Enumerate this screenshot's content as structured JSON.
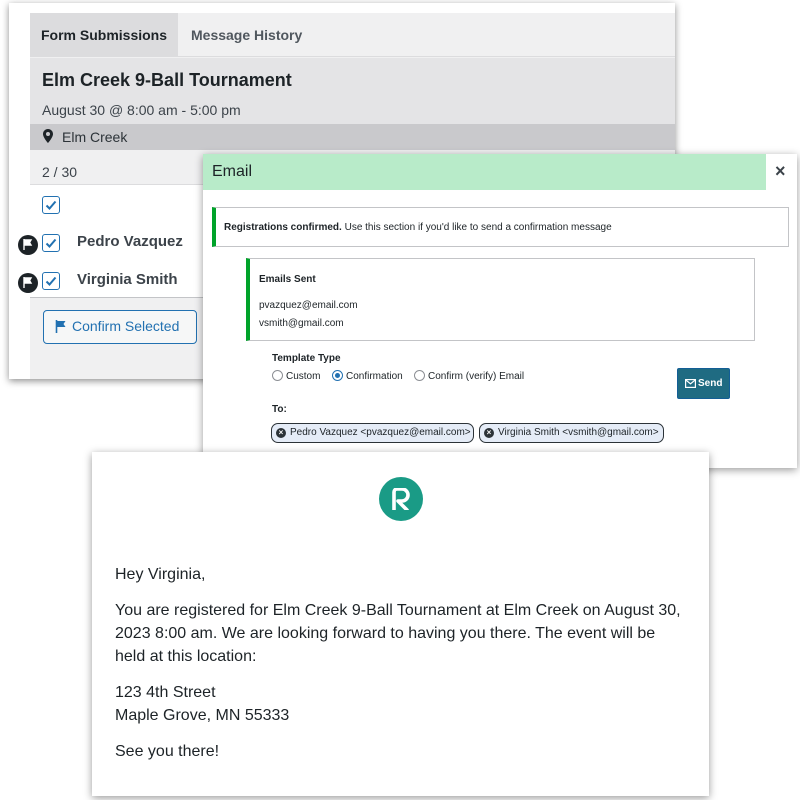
{
  "submissions": {
    "tabs": {
      "active": "Form Submissions",
      "other": "Message History"
    },
    "event": {
      "title": "Elm Creek 9-Ball Tournament",
      "date": "August 30 @ 8:00 am - 5:00 pm",
      "venue": "Elm Creek"
    },
    "count": "2 / 30",
    "rows": [
      {
        "name": "Pedro Vazquez",
        "checked": true
      },
      {
        "name": "Virginia Smith",
        "checked": true
      }
    ],
    "confirm_button": "Confirm Selected"
  },
  "email_modal": {
    "title": "Email",
    "close": "×",
    "notice_bold": "Registrations confirmed.",
    "notice_text": " Use this section if you'd like to send a confirmation message",
    "emails_sent_title": "Emails Sent",
    "emails_sent": [
      "pvazquez@email.com",
      "vsmith@gmail.com"
    ],
    "template_type_label": "Template Type",
    "template_options": [
      {
        "label": "Custom",
        "selected": false
      },
      {
        "label": "Confirmation",
        "selected": true
      },
      {
        "label": "Confirm (verify) Email",
        "selected": false
      }
    ],
    "send_button": "Send",
    "to_label": "To:",
    "recipients": [
      "Pedro Vazquez <pvazquez@email.com>",
      "Virginia Smith <vsmith@gmail.com>"
    ]
  },
  "email_preview": {
    "greeting": "Hey Virginia,",
    "body": "You are registered for Elm Creek 9-Ball Tournament at Elm Creek on August 30, 2023 8:00 am. We are looking forward to having you there. The event will be held at this location:",
    "address_line1": "123 4th Street",
    "address_line2": "Maple Grove, MN 55333",
    "closing": "See you there!"
  },
  "colors": {
    "accent_blue": "#2271b1",
    "success_green": "#00a32a",
    "modal_header_green": "#b8ebc9",
    "send_button_teal": "#1f6b82",
    "logo_teal": "#1a9b86"
  },
  "icons": [
    "map-pin-icon",
    "flag-icon",
    "checkbox-check-icon",
    "envelope-icon",
    "remove-chip-icon",
    "logo-r-icon"
  ]
}
